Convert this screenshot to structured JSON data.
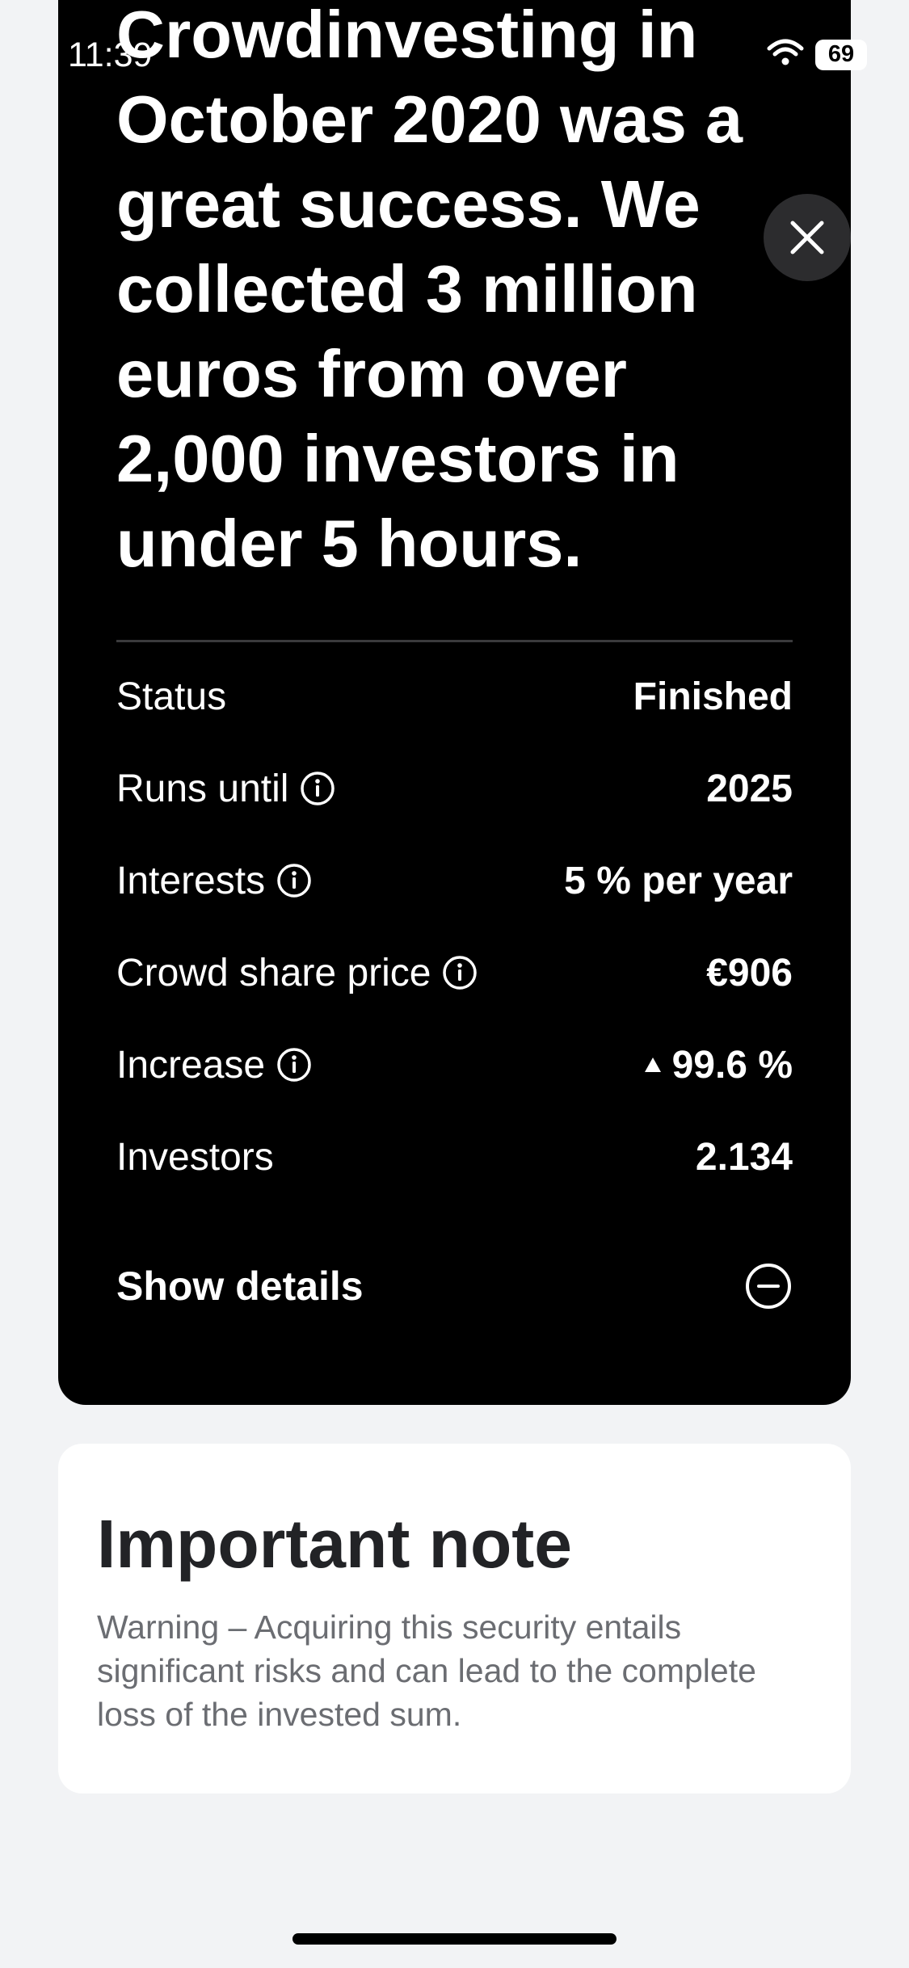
{
  "status_bar": {
    "time": "11:39",
    "battery": "69"
  },
  "campaign": {
    "headline_lines": [
      "Crowdinvesting in",
      "October 2020 was a",
      "great success. We",
      "collected 3 million",
      "euros from over",
      "2,000 investors in",
      "under 5 hours."
    ],
    "stats": [
      {
        "label": "Status",
        "value": "Finished",
        "info": false
      },
      {
        "label": "Runs until",
        "value": "2025",
        "info": true
      },
      {
        "label": "Interests",
        "value": "5 % per year",
        "info": true
      },
      {
        "label": "Crowd share price",
        "value": "€906",
        "info": true
      },
      {
        "label": "Increase",
        "value": "99.6 %",
        "info": true,
        "trend": "up"
      },
      {
        "label": "Investors",
        "value": "2.134",
        "info": false
      }
    ],
    "details_label": "Show details"
  },
  "note": {
    "title": "Important note",
    "text": "Warning – Acquiring this security entails significant risks and can lead to the complete loss of the invested sum."
  },
  "icons": {
    "close": "close-icon",
    "info": "info-icon",
    "collapse": "minus-circle-icon",
    "wifi": "wifi-icon",
    "battery": "battery-icon",
    "trend": "triangle-up-icon"
  },
  "colors": {
    "card": "#000000",
    "background": "#f2f3f5",
    "note_text": "#6b6d72"
  }
}
